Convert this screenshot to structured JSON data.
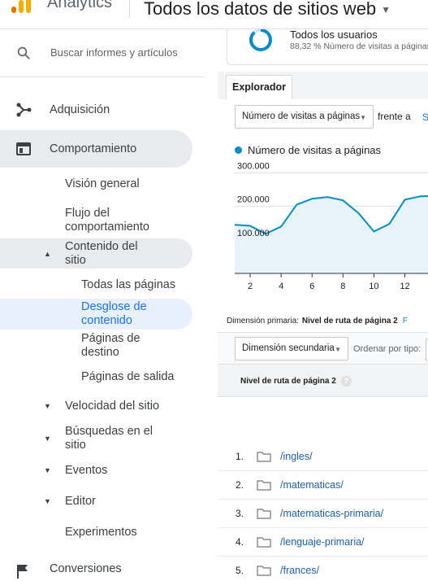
{
  "header": {
    "app_name": "Analytics",
    "property": "Todos los datos de sitios web",
    "colors": {
      "orange": "#e37400",
      "yellow": "#f9ab00"
    }
  },
  "sidebar": {
    "search_placeholder": "Buscar informes y artículos",
    "items": [
      {
        "label": "Adquisición",
        "icon": "acquisition-icon"
      },
      {
        "label": "Comportamiento",
        "icon": "behavior-icon"
      },
      {
        "label": "Visión general"
      },
      {
        "label": "Flujo del comportamiento"
      },
      {
        "label": "Contenido del sitio"
      },
      {
        "label": "Todas las páginas"
      },
      {
        "label": "Desglose de contenido"
      },
      {
        "label": "Páginas de destino"
      },
      {
        "label": "Páginas de salida"
      },
      {
        "label": "Velocidad del sitio"
      },
      {
        "label": "Búsquedas en el sitio"
      },
      {
        "label": "Eventos"
      },
      {
        "label": "Editor"
      },
      {
        "label": "Experimentos"
      },
      {
        "label": "Conversiones",
        "icon": "flag-icon"
      }
    ]
  },
  "segment": {
    "title": "Todos los usuarios",
    "subtitle": "88,32 % Número de visitas a páginas",
    "percent": 88.32
  },
  "explorer": {
    "tab": "Explorador",
    "metric_select": "Número de visitas a páginas",
    "versus": "frente a",
    "versus_link": "S"
  },
  "chart_data": {
    "type": "area",
    "legend": "Número de visitas a páginas",
    "color": "#058dc7",
    "y_ticks": [
      "300.000",
      "200.000",
      "100.000"
    ],
    "x_ticks": [
      "2",
      "4",
      "6",
      "8",
      "10",
      "12"
    ],
    "ylim": [
      0,
      340000
    ],
    "xlim": [
      1,
      13.6
    ],
    "x": [
      1,
      2,
      3,
      4,
      5,
      6,
      7,
      8,
      9,
      10,
      11,
      12,
      13,
      13.6
    ],
    "y": [
      145000,
      142000,
      118000,
      140000,
      205000,
      223000,
      228000,
      218000,
      180000,
      125000,
      148000,
      220000,
      230000,
      231000
    ]
  },
  "table": {
    "primary_dimension_label": "Dimensión primaria:",
    "primary_dimension_value": "Nivel de ruta de página 2",
    "primary_dimension_more": "F",
    "secondary_dimension": "Dimensión secundaria",
    "sort_label": "Ordenar por tipo:",
    "column_header": "Nivel de ruta de página 2",
    "help_symbol": "?",
    "rows": [
      {
        "num": "1.",
        "path": "/ingles/"
      },
      {
        "num": "2.",
        "path": "/matematicas/"
      },
      {
        "num": "3.",
        "path": "/matematicas-primaria/"
      },
      {
        "num": "4.",
        "path": "/lenguaje-primaria/"
      },
      {
        "num": "5.",
        "path": "/frances/"
      }
    ]
  }
}
